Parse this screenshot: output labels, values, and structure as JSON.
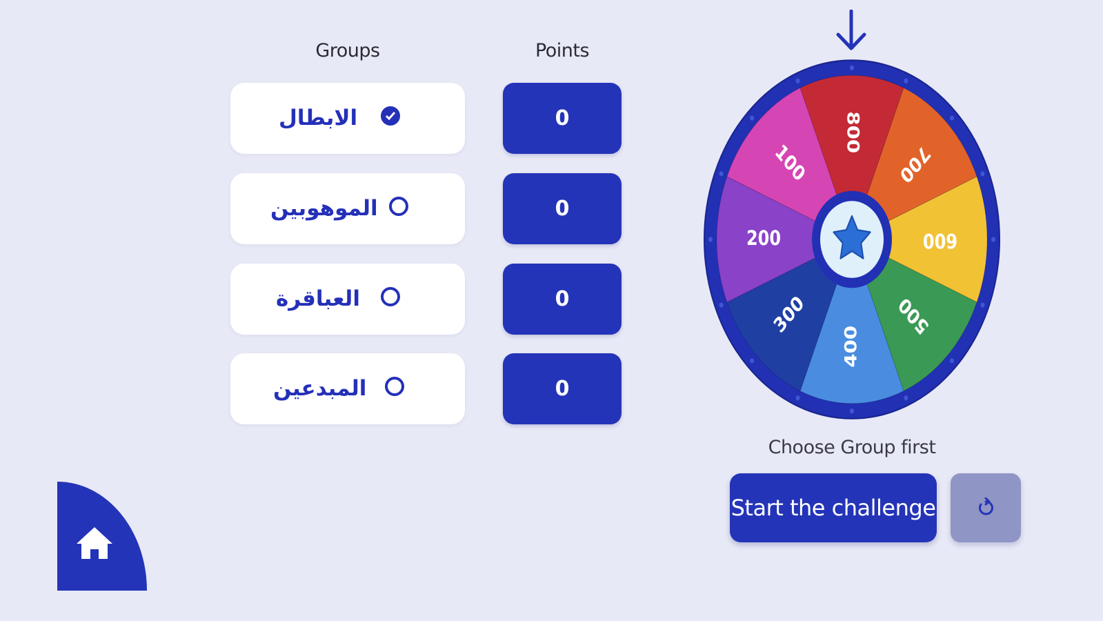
{
  "headers": {
    "groups": "Groups",
    "points": "Points"
  },
  "groups": [
    {
      "name": "الابطال",
      "selected": true,
      "points": "0"
    },
    {
      "name": "الموهوبين",
      "selected": false,
      "points": "0"
    },
    {
      "name": "العباقرة",
      "selected": false,
      "points": "0"
    },
    {
      "name": "المبدعين",
      "selected": false,
      "points": "0"
    }
  ],
  "wheel": {
    "segments": [
      {
        "label": "800",
        "color": "#c42a35"
      },
      {
        "label": "700",
        "color": "#e2632a"
      },
      {
        "label": "600",
        "color": "#f2c235"
      },
      {
        "label": "500",
        "color": "#3a9a55"
      },
      {
        "label": "400",
        "color": "#4a8de0"
      },
      {
        "label": "300",
        "color": "#1f3fa3"
      },
      {
        "label": "200",
        "color": "#8a42c8"
      },
      {
        "label": "100",
        "color": "#d645b4"
      }
    ],
    "center_icon": "star-icon",
    "pointer_icon": "arrow-down-icon"
  },
  "controls": {
    "status": "Choose Group first",
    "start_label": "Start the challenge",
    "reset_icon": "reset-icon",
    "home_icon": "home-icon"
  },
  "colors": {
    "background": "#e8e9f6",
    "primary": "#2434b8",
    "reset_button": "#8f95c4"
  }
}
